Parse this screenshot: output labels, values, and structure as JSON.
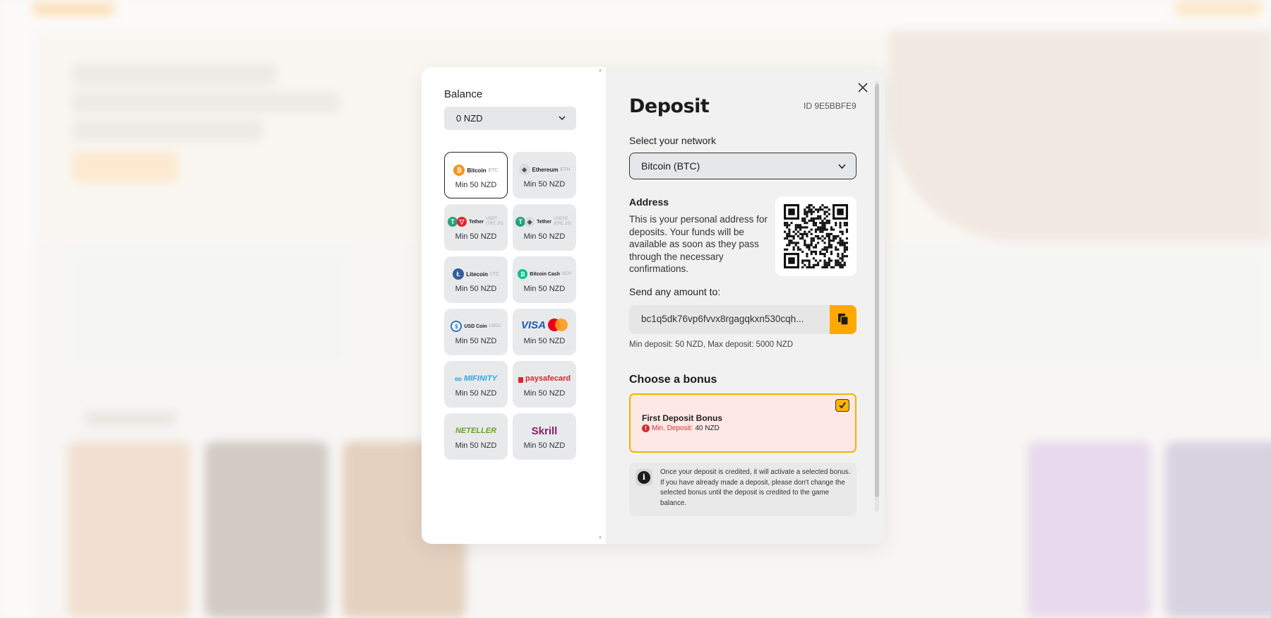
{
  "deposit_modal": {
    "balance": {
      "label": "Balance",
      "value": "0 NZD"
    },
    "payment_methods": [
      {
        "name": "Bitcoin",
        "ticker": "BTC",
        "min": "Min 50 NZD",
        "selected": true,
        "icon": "bitcoin-icon",
        "color": "#f7931a"
      },
      {
        "name": "Ethereum",
        "ticker": "ETH",
        "min": "Min 50 NZD",
        "selected": false,
        "icon": "ethereum-icon",
        "color": "#8a92b2"
      },
      {
        "name": "Tether",
        "ticker": "USDT (TRC 20)",
        "min": "Min 50 NZD",
        "selected": false,
        "icon": "tether-trc20-icon",
        "color": "#26a17b"
      },
      {
        "name": "Tether",
        "ticker": "USDTE (ERC 20)",
        "min": "Min 50 NZD",
        "selected": false,
        "icon": "tether-erc20-icon",
        "color": "#26a17b"
      },
      {
        "name": "Litecoin",
        "ticker": "LTC",
        "min": "Min 50 NZD",
        "selected": false,
        "icon": "litecoin-icon",
        "color": "#345d9d"
      },
      {
        "name": "Bitcoin Cash",
        "ticker": "BCH",
        "min": "Min 50 NZD",
        "selected": false,
        "icon": "bitcoin-cash-icon",
        "color": "#0ac18e"
      },
      {
        "name": "USD Coin",
        "ticker": "USDC",
        "min": "Min 50 NZD",
        "selected": false,
        "icon": "usd-coin-icon",
        "color": "#2775ca"
      },
      {
        "name": "VISA",
        "ticker": "",
        "min": "Min 50 NZD",
        "selected": false,
        "icon": "visa-mastercard-icon",
        "color": "#1a1f71"
      },
      {
        "name": "MIFINITY",
        "ticker": "",
        "min": "Min 50 NZD",
        "selected": false,
        "icon": "mifinity-icon",
        "color": "#2ca8e0"
      },
      {
        "name": "paysafecard",
        "ticker": "",
        "min": "Min 50 NZD",
        "selected": false,
        "icon": "paysafecard-icon",
        "color": "#d8262f"
      },
      {
        "name": "NETELLER",
        "ticker": "",
        "min": "Min 50 NZD",
        "selected": false,
        "icon": "neteller-icon",
        "color": "#83ba3b"
      },
      {
        "name": "Skrill",
        "ticker": "",
        "min": "Min 50 NZD",
        "selected": false,
        "icon": "skrill-icon",
        "color": "#862165"
      }
    ],
    "title": "Deposit",
    "transaction_id": "ID 9E5BBFE9",
    "network": {
      "label": "Select your network",
      "value": "Bitcoin (BTC)"
    },
    "address": {
      "heading": "Address",
      "description": "This is your personal address for deposits. Your funds will be available as soon as they pass through the necessary confirmations.",
      "send_label": "Send any amount to:",
      "value": "bc1q5dk76vp6fvvx8rgagqkxn530cqh...",
      "limits": "Min deposit: 50 NZD, Max deposit: 5000 NZD"
    },
    "bonus": {
      "heading": "Choose a bonus",
      "name": "First Deposit Bonus",
      "min_label": "Min. Deposit:",
      "min_value": "40 NZD",
      "selected": true,
      "info": "Once your deposit is credited, it will activate a selected bonus. If you have already made a deposit, please don't change the selected bonus until the deposit is credited to the game balance."
    },
    "colors": {
      "accent": "#ffa800",
      "bonus_border": "#f0b400",
      "bonus_bg": "#fde8e6",
      "warning": "#d03030"
    }
  }
}
